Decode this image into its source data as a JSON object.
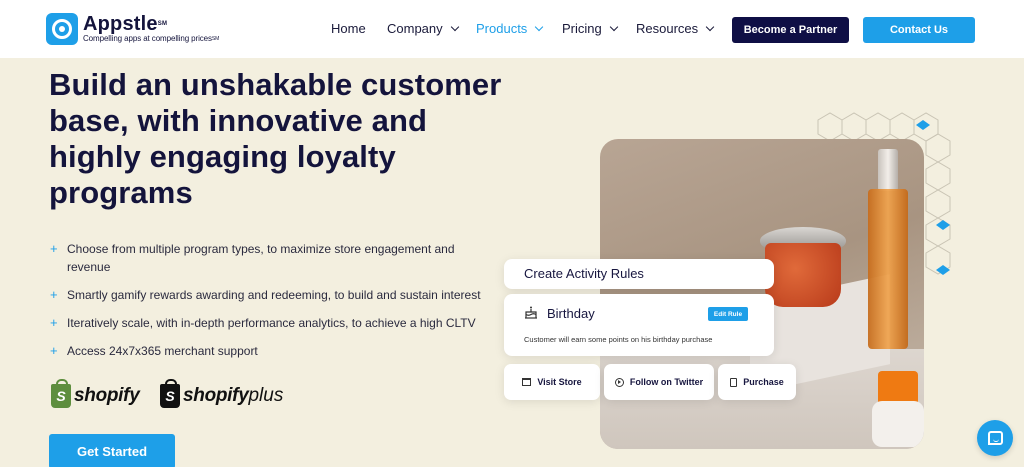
{
  "brand": {
    "name": "Appstle",
    "name_mark": "SM",
    "tagline": "Compelling apps at compelling prices",
    "tagline_mark": "SM"
  },
  "nav": {
    "items": [
      {
        "label": "Home",
        "has_dropdown": false,
        "active": false
      },
      {
        "label": "Company",
        "has_dropdown": true,
        "active": false
      },
      {
        "label": "Products",
        "has_dropdown": true,
        "active": true
      },
      {
        "label": "Pricing",
        "has_dropdown": true,
        "active": false
      },
      {
        "label": "Resources",
        "has_dropdown": true,
        "active": false
      }
    ],
    "partner_label": "Become a Partner",
    "contact_label": "Contact Us"
  },
  "hero": {
    "title": "Build an unshakable customer base, with innovative and highly engaging loyalty programs",
    "features": [
      "Choose from multiple program types, to maximize store engagement and revenue",
      "Smartly gamify rewards awarding and redeeming, to build and sustain interest",
      "Iteratively scale, with in-depth performance analytics, to achieve a high CLTV",
      "Access 24x7x365 merchant support"
    ],
    "bullet_symbol": "+",
    "platforms": {
      "shopify": "shopify",
      "shopify_plus_a": "shopify",
      "shopify_plus_b": "plus"
    },
    "cta_label": "Get Started"
  },
  "illustration": {
    "rules_title": "Create Activity Rules",
    "birthday_title": "Birthday",
    "edit_rule_label": "Edit Rule",
    "birthday_desc": "Customer will earn some points on his birthday purchase",
    "actions": [
      {
        "label": "Visit Store",
        "icon": "store-icon"
      },
      {
        "label": "Follow on Twitter",
        "icon": "twitter-icon"
      },
      {
        "label": "Purchase",
        "icon": "receipt-icon"
      }
    ]
  },
  "colors": {
    "accent": "#1e9fe8",
    "navy": "#0f0f45",
    "background": "#f3efdf",
    "heading": "#14143c"
  }
}
